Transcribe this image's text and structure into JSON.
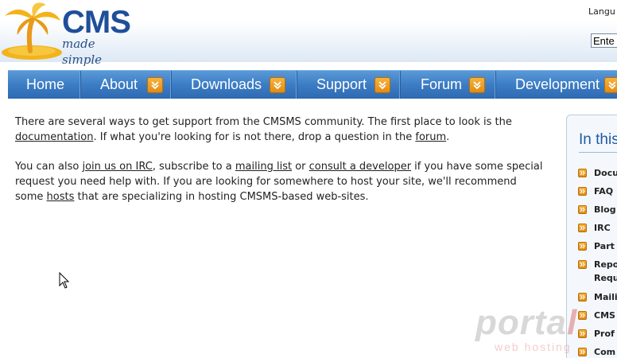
{
  "header": {
    "logo": {
      "wordmark": "CMS",
      "tagline": "made simple"
    },
    "language_label": "Langu",
    "search_value": "Ente"
  },
  "nav": {
    "items": [
      {
        "label": "Home",
        "has_arrow": false
      },
      {
        "label": "About",
        "has_arrow": true
      },
      {
        "label": "Downloads",
        "has_arrow": true
      },
      {
        "label": "Support",
        "has_arrow": true
      },
      {
        "label": "Forum",
        "has_arrow": true
      },
      {
        "label": "Development",
        "has_arrow": true
      }
    ]
  },
  "content": {
    "p1": {
      "t1": "There are several ways to get support from the CMSMS community. The first place to look is the ",
      "link_documentation": "documentation",
      "t2": ". If what you're looking for is not there, drop a question in the ",
      "link_forum": "forum",
      "t3": "."
    },
    "p2": {
      "t1": "You can also ",
      "link_irc": "join us on IRC",
      "t2": ", subscribe to a ",
      "link_mailing": "mailing list",
      "t3": " or ",
      "link_consult": "consult a developer",
      "t4": " if you have some special request you need help with. If you are looking for somewhere to host your site, we'll recommend some ",
      "link_hosts": "hosts",
      "t5": " that are specializing in hosting CMSMS-based web-sites."
    }
  },
  "sidebar": {
    "title": "In this",
    "items": [
      "Docu",
      "FAQ",
      "Blog",
      "IRC",
      "Part",
      "Repo\nRequ",
      "Maili",
      "CMS",
      "Prof",
      "Com"
    ]
  },
  "watermark": {
    "word_main": "porta",
    "word_end": "l",
    "sub": "web hosting"
  },
  "colors": {
    "nav_blue": "#3c7cc4",
    "accent_orange": "#e28d12",
    "brand_blue": "#1f4f9a"
  }
}
